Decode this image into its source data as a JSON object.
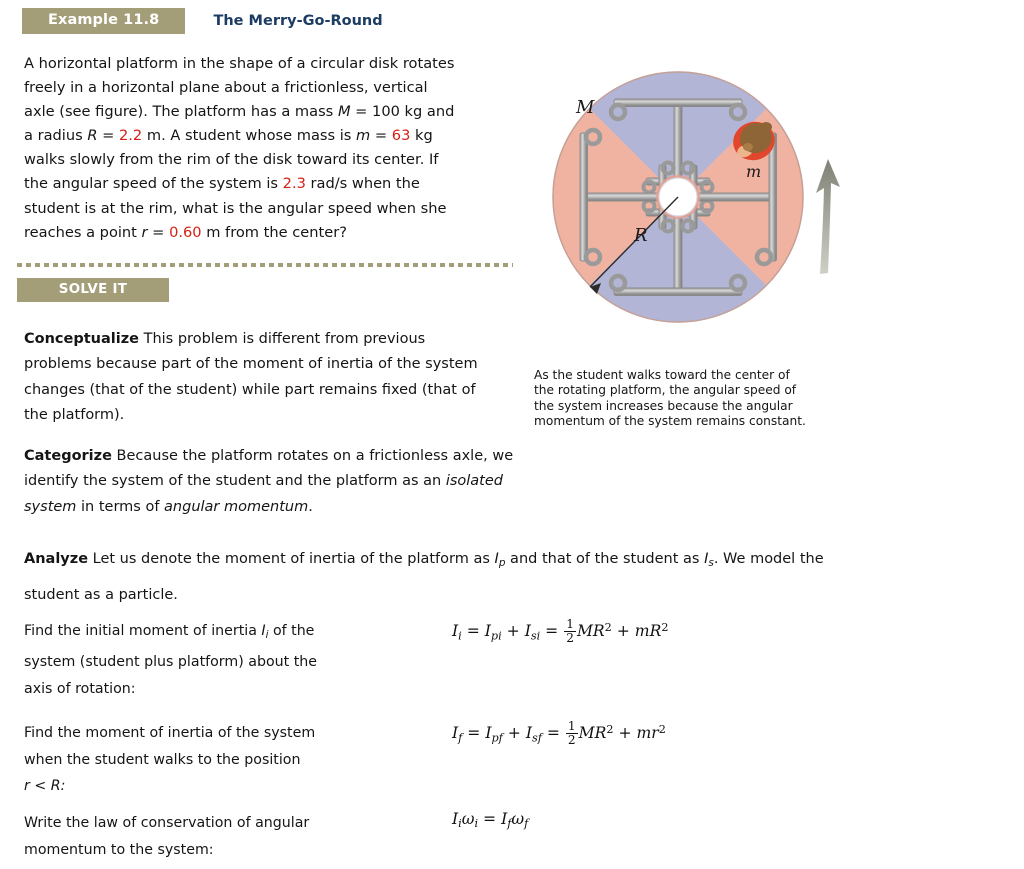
{
  "header": {
    "example_badge": "Example 11.8",
    "example_title": "The Merry-Go-Round",
    "badge_color": "#a39d78",
    "title_color": "#1d3c63"
  },
  "problem": {
    "line1": "A horizontal platform in the shape of a circular disk rotates",
    "line2": "freely in a horizontal plane about a frictionless, vertical",
    "line3_a": "axle (see figure). The platform has a mass ",
    "line3_M": "M",
    "line3_b": " = 100 kg and",
    "line4_a": "a radius ",
    "line4_R": "R",
    "line4_eq": " = ",
    "line4_Rval": "2.2",
    "line4_b": " m. A student whose mass is ",
    "line4_m": "m",
    "line4_eq2": " = ",
    "line4_mval": "63",
    "line4_c": " kg",
    "line5": "walks slowly from the rim of the disk toward its center. If",
    "line6_a": "the angular speed of the system is ",
    "line6_omega": "2.3",
    "line6_b": " rad/s when the",
    "line7": "student is at the rim, what is the angular speed when she",
    "line8_a": "reaches a point ",
    "line8_r": "r",
    "line8_eq": " = ",
    "line8_rval": "0.60",
    "line8_b": " m from the center?",
    "value_color": "#d61f12"
  },
  "solve_it": {
    "badge": "SOLVE IT"
  },
  "conceptualize": {
    "label": "Conceptualize",
    "text": " This problem is different from previous problems because part of the moment of inertia of the system changes (that of the student) while part remains fixed (that of the platform)."
  },
  "categorize": {
    "label": "Categorize",
    "text_a": " Because the platform rotates on a frictionless axle, we identify the system of the student and the platform as an ",
    "italic_1": "isolated system",
    "text_b": " in terms of ",
    "italic_2": "angular momentum",
    "text_c": "."
  },
  "analyze": {
    "label": "Analyze",
    "text_a": " Let us denote the moment of inertia of the platform as ",
    "sym_Ip": "I",
    "sub_p": "p",
    "text_b": " and that of the student as ",
    "sym_Is": "I",
    "sub_s": "s",
    "text_c": ". We model the student as a particle."
  },
  "equations": [
    {
      "prompt_line1": "Find the initial moment of inertia ",
      "prompt_sym": "I",
      "prompt_sub": "i",
      "prompt_line1b": " of the",
      "prompt_line2": "system (student plus platform) about the",
      "prompt_line3": "axis of rotation:",
      "math": "I_i = I_pi + I_si = (1/2)MR^2 + mR^2"
    },
    {
      "prompt_line1": "Find the moment of inertia of the system",
      "prompt_line2": "when the student walks to the position",
      "prompt_line3": "r < R:",
      "math": "I_f = I_pf + I_sf = (1/2)MR^2 + mr^2"
    },
    {
      "prompt_line1": "Write the law of conservation of angular",
      "prompt_line2": "momentum to the system:",
      "math": "I_i w_i = I_f w_f"
    }
  ],
  "figure": {
    "label_M": "M",
    "label_m": "m",
    "label_R": "R",
    "caption_line1": "As the student walks toward the center of",
    "caption_line2": "the rotating platform, the angular speed of",
    "caption_line3": "the system increases because the angular",
    "caption_line4": "momentum of the system remains constant.",
    "colors": {
      "quadrant_pink": "#f0b2a1",
      "quadrant_blue": "#b3b5d6",
      "bar_gray": "#a8a8a8",
      "bar_gray_dark": "#8a8a8a",
      "hub_white": "#ffffff",
      "student_shirt": "#e2462d",
      "student_hair": "#8e6536",
      "arrow_gray": "#8f9183"
    }
  }
}
